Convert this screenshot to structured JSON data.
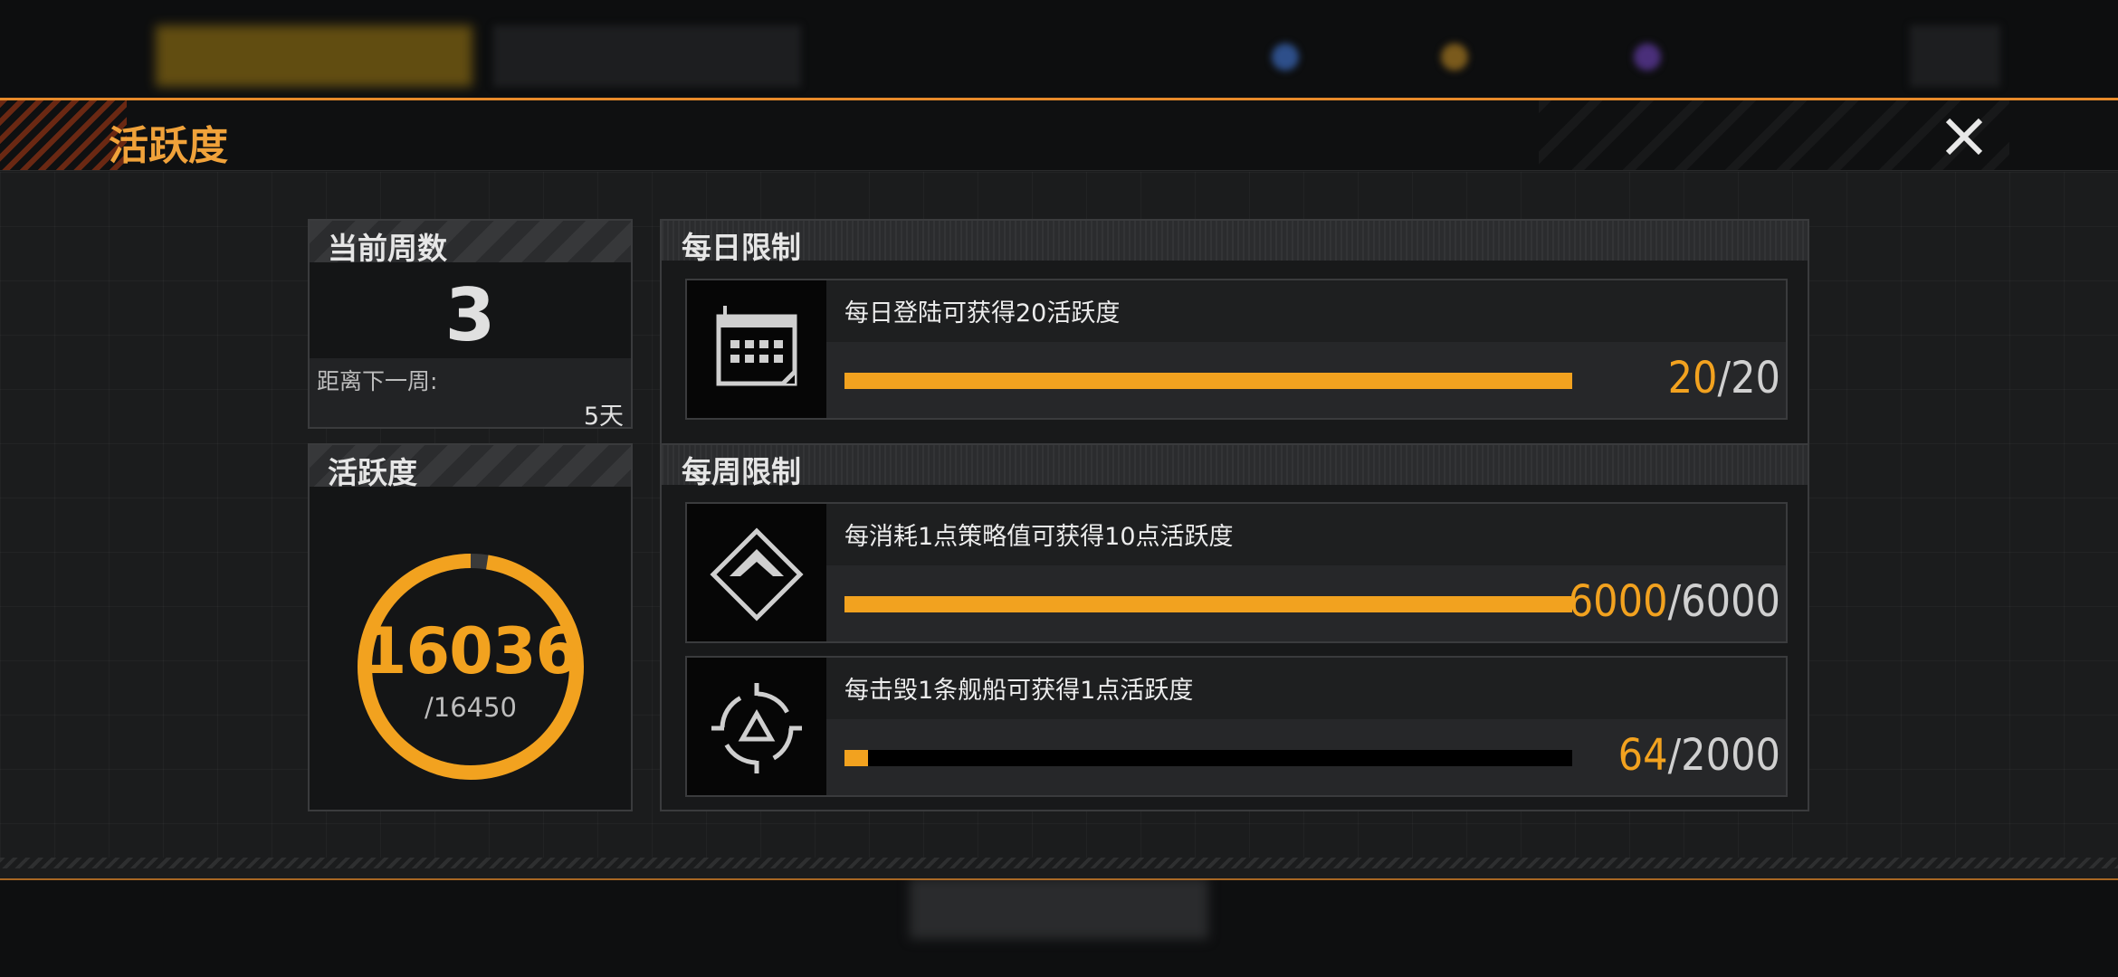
{
  "modal": {
    "title": "活跃度",
    "accent": "#f2a21f"
  },
  "week_panel": {
    "title": "当前周数",
    "week": "3",
    "next_week_label": "距离下一周:",
    "days_left": "5天"
  },
  "activity_panel": {
    "title": "活跃度",
    "current": "16036",
    "max_label": "/16450",
    "fraction": 0.975
  },
  "daily": {
    "title": "每日限制",
    "tasks": [
      {
        "text": "每日登陆可获得20活跃度",
        "current": "20",
        "max": "20",
        "fraction": 1.0,
        "icon": "calendar-icon"
      }
    ]
  },
  "weekly": {
    "title": "每周限制",
    "tasks": [
      {
        "text": "每消耗1点策略值可获得10点活跃度",
        "current": "6000",
        "max": "6000",
        "fraction": 1.0,
        "icon": "strategy-diamond-icon"
      },
      {
        "text": "每击毁1条舰船可获得1点活跃度",
        "current": "64",
        "max": "2000",
        "fraction": 0.032,
        "icon": "crosshair-target-icon"
      }
    ]
  },
  "separator": "/"
}
